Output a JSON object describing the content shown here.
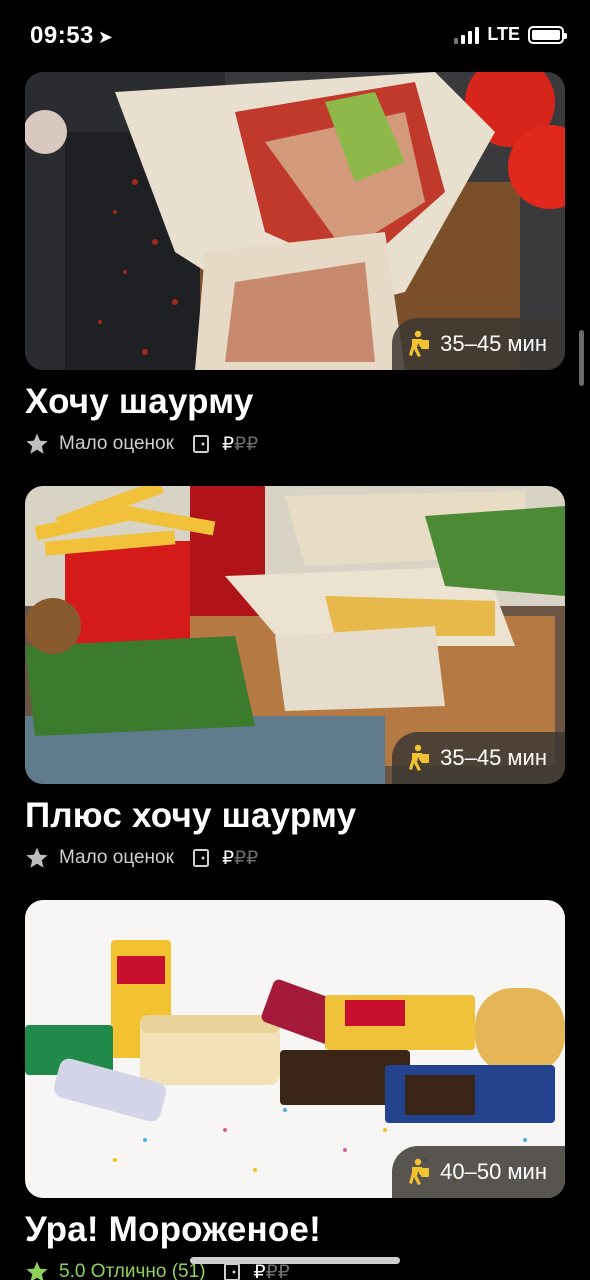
{
  "status_bar": {
    "time": "09:53",
    "network": "LTE"
  },
  "restaurants": [
    {
      "name": "Хочу шаурму",
      "delivery_time": "35–45 мин",
      "rating_text": "Мало оценок",
      "price_active": "₽",
      "price_dim": "₽₽",
      "image_subject": "shawarma wraps on wooden board"
    },
    {
      "name": "Плюс хочу шаурму",
      "delivery_time": "35–45 мин",
      "rating_text": "Мало оценок",
      "price_active": "₽",
      "price_dim": "₽₽",
      "image_subject": "shawarma with fries and cola"
    },
    {
      "name": "Ура! Мороженое!",
      "delivery_time": "40–50 мин",
      "rating_text": "5.0 Отлично (51)",
      "price_active": "₽",
      "price_dim": "₽₽",
      "image_subject": "assorted ice cream packages"
    }
  ],
  "colors": {
    "background": "#000000",
    "badge_bg": "#3c3732",
    "rating_good": "#8fd15a",
    "price_dim": "#6d6d6d",
    "courier_icon": "#f2c230"
  },
  "icons": {
    "courier": "courier-walking-icon",
    "star": "star-icon",
    "price_tag": "door-icon"
  }
}
